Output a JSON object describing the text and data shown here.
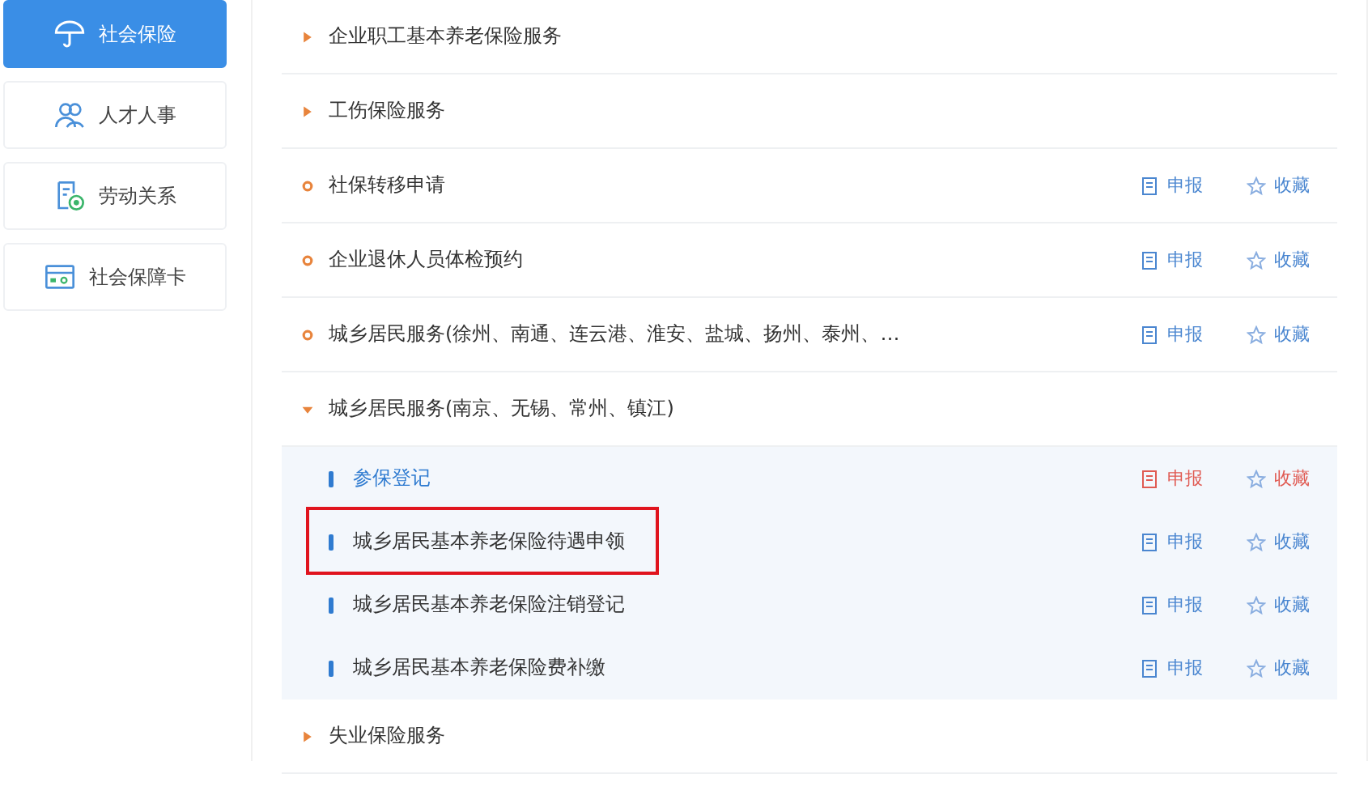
{
  "sidebar": {
    "items": [
      {
        "label": "社会保险",
        "selected": true
      },
      {
        "label": "人才人事",
        "selected": false
      },
      {
        "label": "劳动关系",
        "selected": false
      },
      {
        "label": "社会保障卡",
        "selected": false
      }
    ]
  },
  "services": [
    {
      "kind": "group",
      "title": "企业职工基本养老保险服务",
      "expanded": false
    },
    {
      "kind": "group",
      "title": "工伤保险服务",
      "expanded": false
    },
    {
      "kind": "service",
      "title": "社保转移申请",
      "apply": "申报",
      "favorite": "收藏"
    },
    {
      "kind": "service",
      "title": "企业退休人员体检预约",
      "apply": "申报",
      "favorite": "收藏"
    },
    {
      "kind": "service",
      "title": "城乡居民服务(徐州、南通、连云港、淮安、盐城、扬州、泰州、…",
      "apply": "申报",
      "favorite": "收藏"
    },
    {
      "kind": "group",
      "title": "城乡居民服务(南京、无锡、常州、镇江)",
      "expanded": true,
      "children": [
        {
          "title": "参保登记",
          "apply": "申报",
          "favorite": "收藏",
          "active": true,
          "highlighted": false
        },
        {
          "title": "城乡居民基本养老保险待遇申领",
          "apply": "申报",
          "favorite": "收藏",
          "active": false,
          "highlighted": true
        },
        {
          "title": "城乡居民基本养老保险注销登记",
          "apply": "申报",
          "favorite": "收藏",
          "active": false,
          "highlighted": false
        },
        {
          "title": "城乡居民基本养老保险费补缴",
          "apply": "申报",
          "favorite": "收藏",
          "active": false,
          "highlighted": false
        }
      ]
    },
    {
      "kind": "group",
      "title": "失业保险服务",
      "expanded": false
    }
  ]
}
